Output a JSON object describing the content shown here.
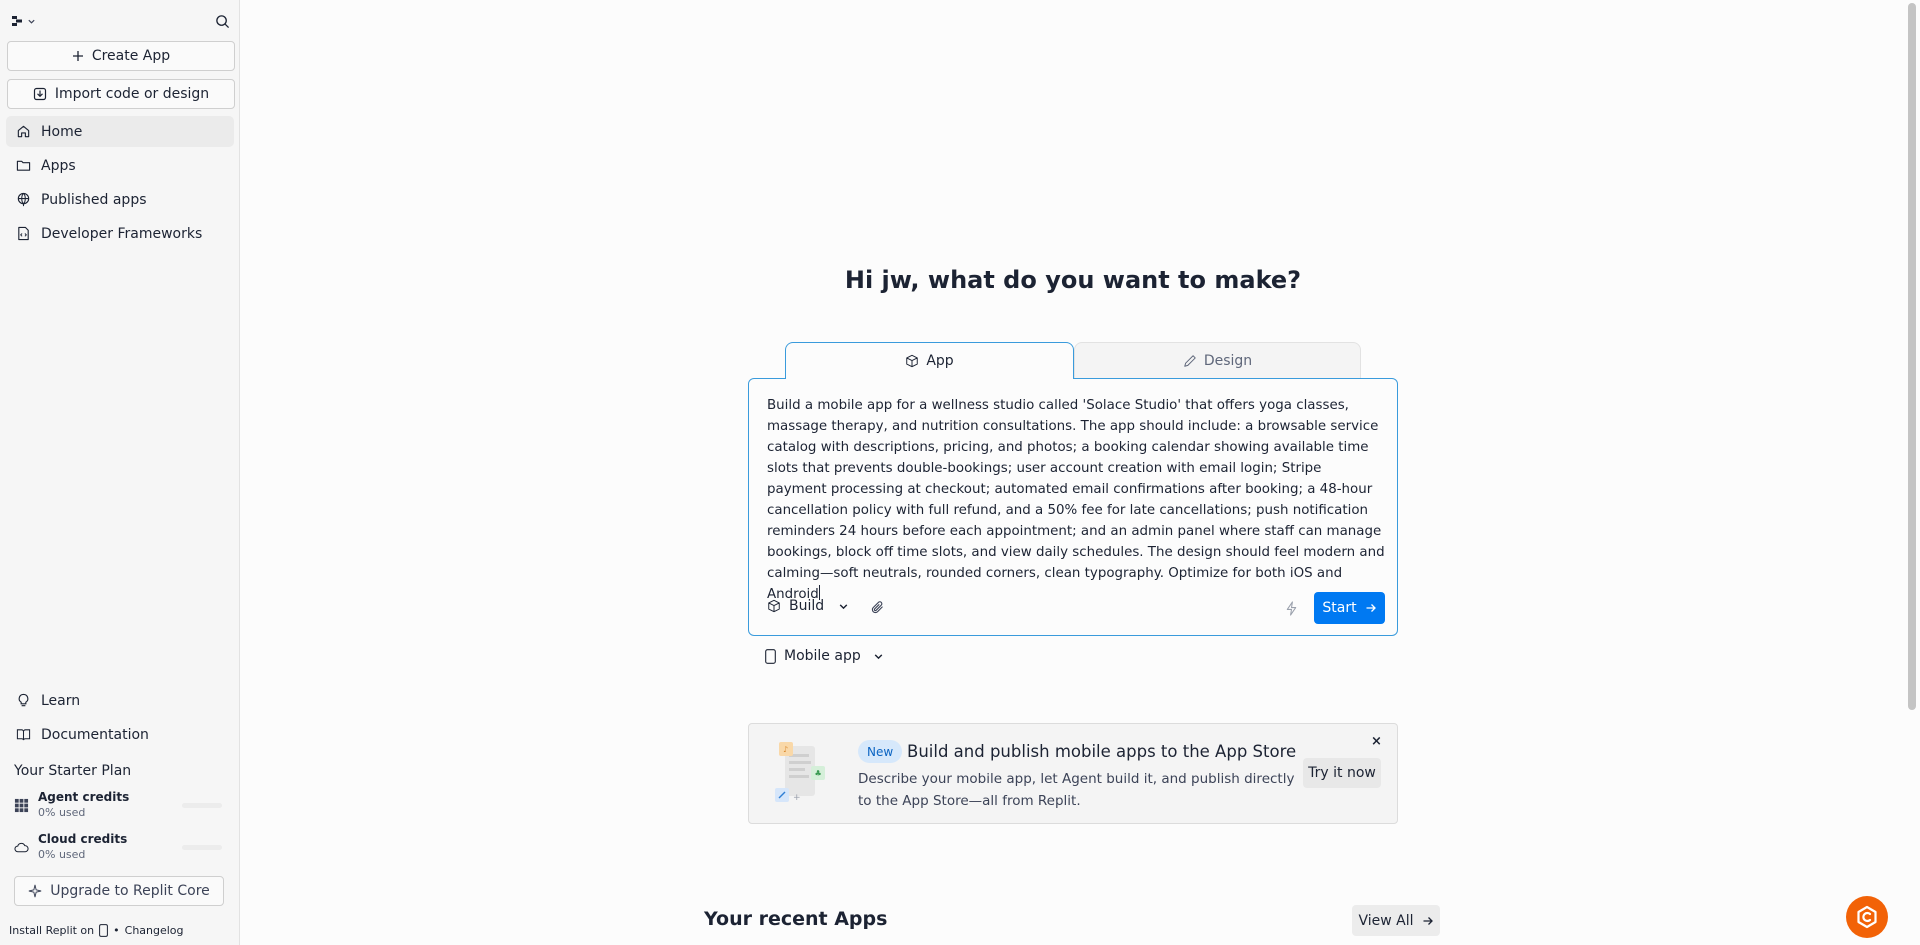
{
  "sidebar": {
    "create_label": "Create App",
    "import_label": "Import code or design",
    "nav": [
      {
        "label": "Home"
      },
      {
        "label": "Apps"
      },
      {
        "label": "Published apps"
      },
      {
        "label": "Developer Frameworks"
      }
    ],
    "learn_label": "Learn",
    "docs_label": "Documentation",
    "plan_title": "Your Starter Plan",
    "credits": [
      {
        "name": "Agent credits",
        "used": "0% used"
      },
      {
        "name": "Cloud credits",
        "used": "0% used"
      }
    ],
    "upgrade_label": "Upgrade to Replit Core",
    "install_label": "Install Replit on",
    "changelog_label": "Changelog"
  },
  "main": {
    "heading": "Hi jw, what do you want to make?",
    "tabs": [
      {
        "label": "App"
      },
      {
        "label": "Design"
      }
    ],
    "prompt": "Build a mobile app for a wellness studio called 'Solace Studio' that offers yoga classes, massage therapy, and nutrition consultations. The app should include: a browsable service catalog with descriptions, pricing, and photos; a booking calendar showing available time slots that prevents double-bookings; user account creation with email login; Stripe payment processing at checkout; automated email confirmations after booking; a 48-hour cancellation policy with full refund, and a 50% fee for late cancellations; push notification reminders 24 hours before each appointment; and an admin panel where staff can manage bookings, block off time slots, and view daily schedules. The design should feel modern and calming—soft neutrals, rounded corners, clean typography. Optimize for both iOS and Android",
    "build_label": "Build",
    "start_label": "Start",
    "platform_label": "Mobile app",
    "promo": {
      "badge": "New",
      "title": "Build and publish mobile apps to the App Store",
      "desc": "Describe your mobile app, let Agent build it, and publish directly to the App Store—all from Replit.",
      "try_label": "Try it now",
      "close": "×"
    },
    "recent_title": "Your recent Apps",
    "view_all_label": "View All"
  },
  "colors": {
    "accent": "#0079f2",
    "focus_border": "#3a9bdc",
    "fab": "#f26207"
  }
}
